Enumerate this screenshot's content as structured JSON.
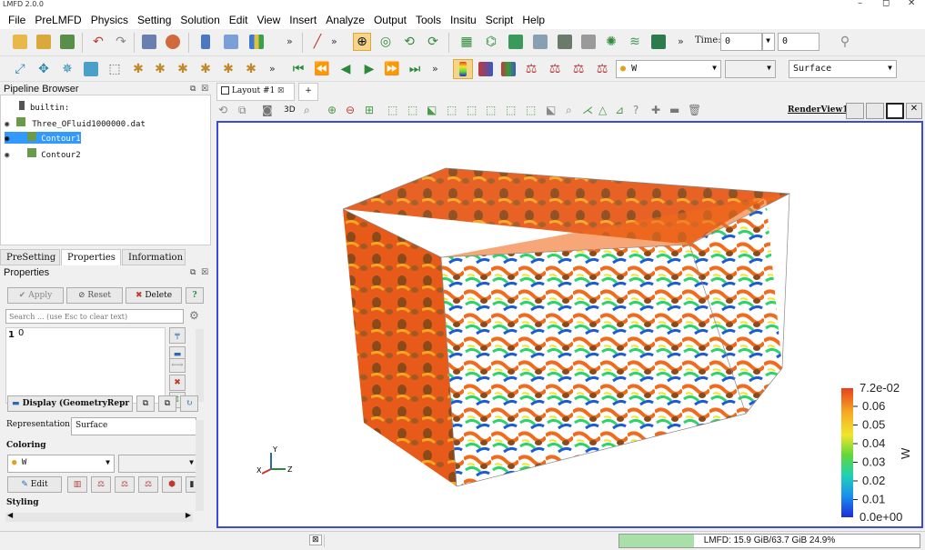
{
  "window": {
    "title": "LMFD 2.0.0"
  },
  "menu": [
    "File",
    "PreLMFD",
    "Physics",
    "Setting",
    "Solution",
    "Edit",
    "View",
    "Insert",
    "Analyze",
    "Output",
    "Tools",
    "Insitu",
    "Script",
    "Help"
  ],
  "toolbar": {
    "time_label": "Time:",
    "time_value": "0",
    "time_step": "0",
    "color_by": "W",
    "representation": "Surface"
  },
  "pipeline": {
    "title": "Pipeline Browser",
    "items": [
      "builtin:",
      "Three_OFluid1000000.dat",
      "Contour1",
      "Contour2"
    ]
  },
  "tabs": [
    "PreSetting",
    "Properties",
    "Information"
  ],
  "properties": {
    "title": "Properties",
    "apply": "Apply",
    "reset": "Reset",
    "delete": "Delete",
    "help": "?",
    "search_placeholder": "Search ... (use Esc to clear text)",
    "isovalue_index": "1",
    "isovalue": "0",
    "display_label": "Display (GeometryRepr",
    "representation_label": "Representation",
    "representation_value": "Surface",
    "coloring_label": "Coloring",
    "coloring_value": "W",
    "edit_label": "Edit",
    "styling_label": "Styling"
  },
  "layout": {
    "tab": "Layout #1",
    "add": "+",
    "view_name": "RenderView1",
    "mode_3d": "3D"
  },
  "colorbar": {
    "title": "W",
    "max_label": "7.2e-02",
    "min_label": "0.0e+00",
    "ticks": [
      "0.06",
      "0.05",
      "0.04",
      "0.03",
      "0.02",
      "0.01"
    ],
    "colors": [
      "#e8401c",
      "#f5a623",
      "#f2e52b",
      "#5fd83a",
      "#1fd1b6",
      "#1a8cf0",
      "#1f2bd6"
    ]
  },
  "axes": {
    "x": "X",
    "y": "Y",
    "z": "Z"
  },
  "status": {
    "memory": "LMFD: 15.9 GiB/63.7 GiB 24.9%",
    "memory_fraction": 0.249
  }
}
